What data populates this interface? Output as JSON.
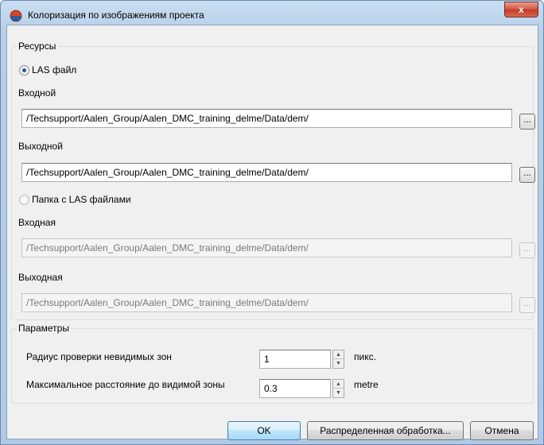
{
  "window": {
    "title": "Колоризация по изображениям проекта",
    "close_label": "x"
  },
  "resources": {
    "title": "Ресурсы",
    "las_file_radio": "LAS файл",
    "input_label": "Входной",
    "input_path": "/Techsupport/Aalen_Group/Aalen_DMC_training_delme/Data/dem/",
    "output_label": "Выходной",
    "output_path": "/Techsupport/Aalen_Group/Aalen_DMC_training_delme/Data/dem/",
    "folder_radio": "Папка с LAS файлами",
    "folder_input_label": "Входная",
    "folder_input_path": "/Techsupport/Aalen_Group/Aalen_DMC_training_delme/Data/dem/",
    "folder_output_label": "Выходная",
    "folder_output_path": "/Techsupport/Aalen_Group/Aalen_DMC_training_delme/Data/dem/",
    "browse_label": "..."
  },
  "params": {
    "title": "Параметры",
    "radius_label": "Радиус проверки невидимых зон",
    "radius_value": "1",
    "radius_unit": "пикс.",
    "distance_label": "Максимальное расстояние до видимой зоны",
    "distance_value": "0.3",
    "distance_unit": "metre"
  },
  "buttons": {
    "ok": "OK",
    "distributed": "Распределенная обработка...",
    "cancel": "Отмена"
  }
}
